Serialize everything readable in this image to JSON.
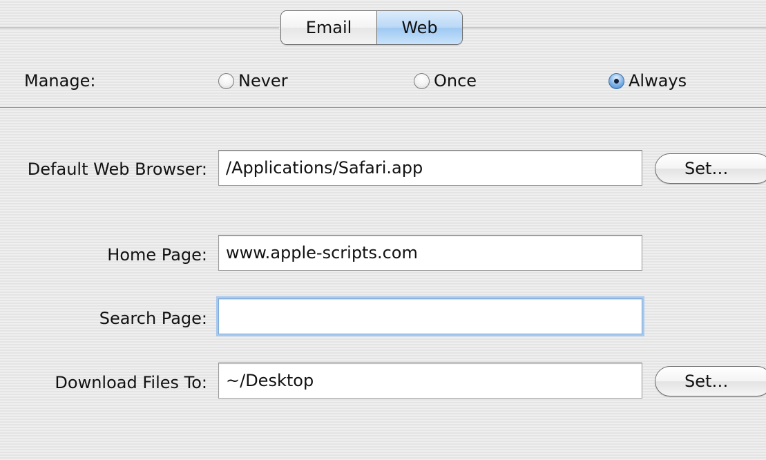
{
  "tabs": [
    {
      "label": "Email",
      "selected": false
    },
    {
      "label": "Web",
      "selected": true
    }
  ],
  "manage": {
    "label": "Manage:",
    "options": [
      "Never",
      "Once",
      "Always"
    ],
    "selected": "Always"
  },
  "fields": {
    "browser": {
      "label": "Default Web Browser:",
      "value": "/Applications/Safari.app"
    },
    "home": {
      "label": "Home Page:",
      "value": "www.apple-scripts.com"
    },
    "search": {
      "label": "Search Page:",
      "value": ""
    },
    "download": {
      "label": "Download Files To:",
      "value": "~/Desktop"
    }
  },
  "set_button_label": "Set…",
  "colors": {
    "accent": "#7fa9d6",
    "selected_tab": "#b9d8f7"
  }
}
